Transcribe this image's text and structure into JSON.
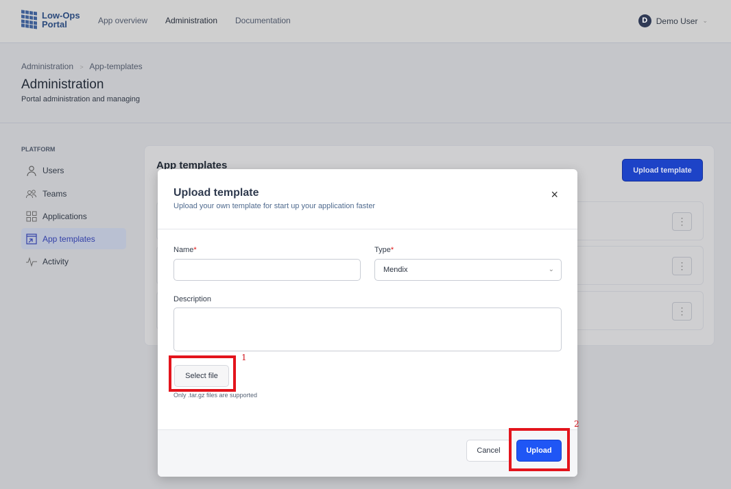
{
  "header": {
    "logo_line1": "Low-Ops",
    "logo_line2": "Portal",
    "nav": [
      "App overview",
      "Administration",
      "Documentation"
    ],
    "user": {
      "initial": "D",
      "name": "Demo User"
    }
  },
  "breadcrumb": {
    "root": "Administration",
    "separator": ">",
    "current": "App-templates"
  },
  "page": {
    "title": "Administration",
    "subtitle": "Portal administration and managing"
  },
  "sidebar": {
    "section": "PLATFORM",
    "items": [
      {
        "label": "Users",
        "icon": "user-icon"
      },
      {
        "label": "Teams",
        "icon": "team-icon"
      },
      {
        "label": "Applications",
        "icon": "grid-icon"
      },
      {
        "label": "App templates",
        "icon": "template-icon",
        "active": true
      },
      {
        "label": "Activity",
        "icon": "activity-icon"
      }
    ]
  },
  "card": {
    "title": "App templates",
    "upload_button": "Upload template",
    "kebab": "⋮"
  },
  "modal": {
    "title": "Upload template",
    "subtitle": "Upload your own template for start up your application faster",
    "close": "×",
    "name_label": "Name",
    "name_value": "",
    "required": "*",
    "type_label": "Type",
    "type_value": "Mendix",
    "description_label": "Description",
    "description_value": "",
    "select_file": "Select file",
    "hint": "Only .tar.gz files are supported",
    "cancel": "Cancel",
    "upload": "Upload"
  },
  "annotations": [
    "1",
    "2"
  ],
  "colors": {
    "primary": "#1f56f5",
    "annotation": "#e3141c",
    "required": "#dd1111"
  }
}
